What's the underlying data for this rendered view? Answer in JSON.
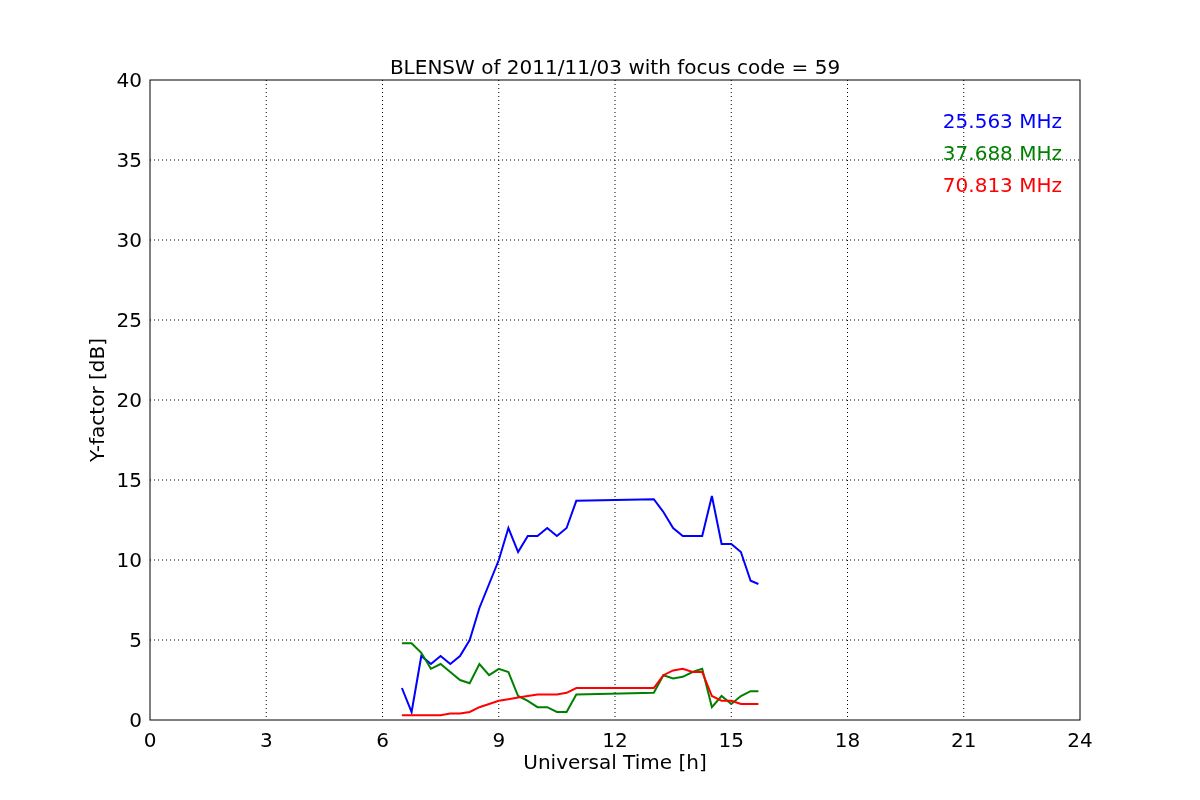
{
  "figure": {
    "chart_data": {
      "type": "line",
      "title": "BLENSW of 2011/11/03 with focus code = 59",
      "xlabel": "Universal Time [h]",
      "ylabel": "Y-factor [dB]",
      "x": [
        6.5,
        6.75,
        7.0,
        7.25,
        7.5,
        7.75,
        8.0,
        8.25,
        8.5,
        8.75,
        9.0,
        9.25,
        9.5,
        9.75,
        10.0,
        10.25,
        10.5,
        10.75,
        11.0,
        13.0,
        13.25,
        13.5,
        13.75,
        14.0,
        14.25,
        14.5,
        14.75,
        15.0,
        15.25,
        15.5,
        15.7
      ],
      "series": [
        {
          "name": "25.563 MHz",
          "color": "#0000ff",
          "values": [
            2,
            0.5,
            4,
            3.5,
            4,
            3.5,
            4,
            5,
            7,
            8.5,
            10,
            12,
            10.5,
            11.5,
            11.5,
            12,
            11.5,
            12,
            13.7,
            13.8,
            13,
            12,
            11.5,
            11.5,
            11.5,
            14,
            11,
            11,
            10.5,
            8.7,
            8.5
          ]
        },
        {
          "name": "37.688 MHz",
          "color": "#008000",
          "values": [
            4.8,
            4.8,
            4.2,
            3.2,
            3.5,
            3.0,
            2.5,
            2.3,
            3.5,
            2.8,
            3.2,
            3.0,
            1.5,
            1.2,
            0.8,
            0.8,
            0.5,
            0.5,
            1.6,
            1.7,
            2.8,
            2.6,
            2.7,
            3.0,
            3.2,
            0.8,
            1.5,
            1.0,
            1.5,
            1.8,
            1.8
          ]
        },
        {
          "name": "70.813 MHz",
          "color": "#ff0000",
          "values": [
            0.3,
            0.3,
            0.3,
            0.3,
            0.3,
            0.4,
            0.4,
            0.5,
            0.8,
            1.0,
            1.2,
            1.3,
            1.4,
            1.5,
            1.6,
            1.6,
            1.6,
            1.7,
            2.0,
            2.0,
            2.8,
            3.1,
            3.2,
            3.0,
            3.0,
            1.5,
            1.2,
            1.2,
            1.0,
            1.0,
            1.0
          ]
        }
      ],
      "xlim": [
        0,
        24
      ],
      "ylim": [
        0,
        40
      ],
      "xticks": [
        0,
        3,
        6,
        9,
        12,
        15,
        18,
        21,
        24
      ],
      "yticks": [
        0,
        5,
        10,
        15,
        20,
        25,
        30,
        35,
        40
      ],
      "grid": true
    }
  }
}
